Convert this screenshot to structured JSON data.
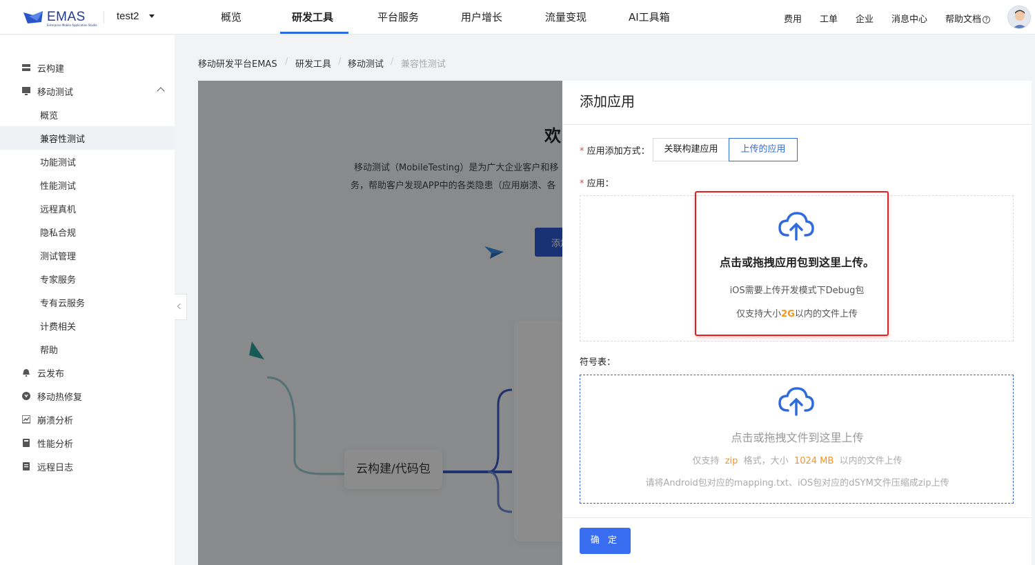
{
  "header": {
    "logo_text": "EMAS",
    "logo_sub": "Enterprise Mobile Application Studio",
    "project": "test2",
    "nav": [
      "概览",
      "研发工具",
      "平台服务",
      "用户增长",
      "流量变现",
      "AI工具箱"
    ],
    "active_nav": "研发工具",
    "right": [
      "费用",
      "工单",
      "企业",
      "消息中心",
      "帮助文档"
    ]
  },
  "sidebar": {
    "items": [
      {
        "label": "云构建",
        "icon": "server-icon"
      },
      {
        "label": "移动测试",
        "icon": "monitor-icon",
        "expanded": true
      },
      {
        "label": "概览",
        "sub": true
      },
      {
        "label": "兼容性测试",
        "sub": true,
        "active": true
      },
      {
        "label": "功能测试",
        "sub": true
      },
      {
        "label": "性能测试",
        "sub": true
      },
      {
        "label": "远程真机",
        "sub": true
      },
      {
        "label": "隐私合规",
        "sub": true
      },
      {
        "label": "测试管理",
        "sub": true
      },
      {
        "label": "专家服务",
        "sub": true
      },
      {
        "label": "专有云服务",
        "sub": true
      },
      {
        "label": "计费相关",
        "sub": true
      },
      {
        "label": "帮助",
        "sub": true
      },
      {
        "label": "云发布",
        "icon": "bell-icon"
      },
      {
        "label": "移动热修复",
        "icon": "hotfix-icon"
      },
      {
        "label": "崩溃分析",
        "icon": "chart-icon"
      },
      {
        "label": "性能分析",
        "icon": "book-icon"
      },
      {
        "label": "远程日志",
        "icon": "log-icon"
      }
    ]
  },
  "breadcrumb": [
    "移动研发平台EMAS",
    "研发工具",
    "移动测试",
    "兼容性测试"
  ],
  "background": {
    "welcome": "欢",
    "desc_line1": "移动测试（MobileTesting）是为广大企业客户和移",
    "desc_line2": "务，帮助客户发现APP中的各类隐患（应用崩溃、各",
    "add_button": "添加",
    "node_label": "云构建/代码包"
  },
  "drawer": {
    "title": "添加应用",
    "method_label": "应用添加方式：",
    "method_options": [
      "关联构建应用",
      "上传的应用"
    ],
    "method_selected": "上传的应用",
    "app_label": "应用：",
    "upload_title": "点击或拖拽应用包到这里上传。",
    "upload_hint1": "iOS需要上传开发模式下Debug包",
    "upload_hint2_prefix": "仅支持大小",
    "upload_hint2_size": "2G",
    "upload_hint2_suffix": "以内的文件上传",
    "symbol_label": "符号表：",
    "symbol_title": "点击或拖拽文件到这里上传",
    "symbol_hint1_prefix": "仅支持",
    "symbol_hint1_format": "zip",
    "symbol_hint1_mid": "格式，大小",
    "symbol_hint1_size": "1024 MB",
    "symbol_hint1_suffix": "以内的文件上传",
    "symbol_hint2": "请将Android包对应的mapping.txt、iOS包对应的dSYM文件压缩成zip上传",
    "confirm": "确 定"
  },
  "colors": {
    "accent": "#2f6bdc",
    "primary_button": "#3a6ef0",
    "highlight_border": "#e02020",
    "orange": "#f5941d"
  }
}
